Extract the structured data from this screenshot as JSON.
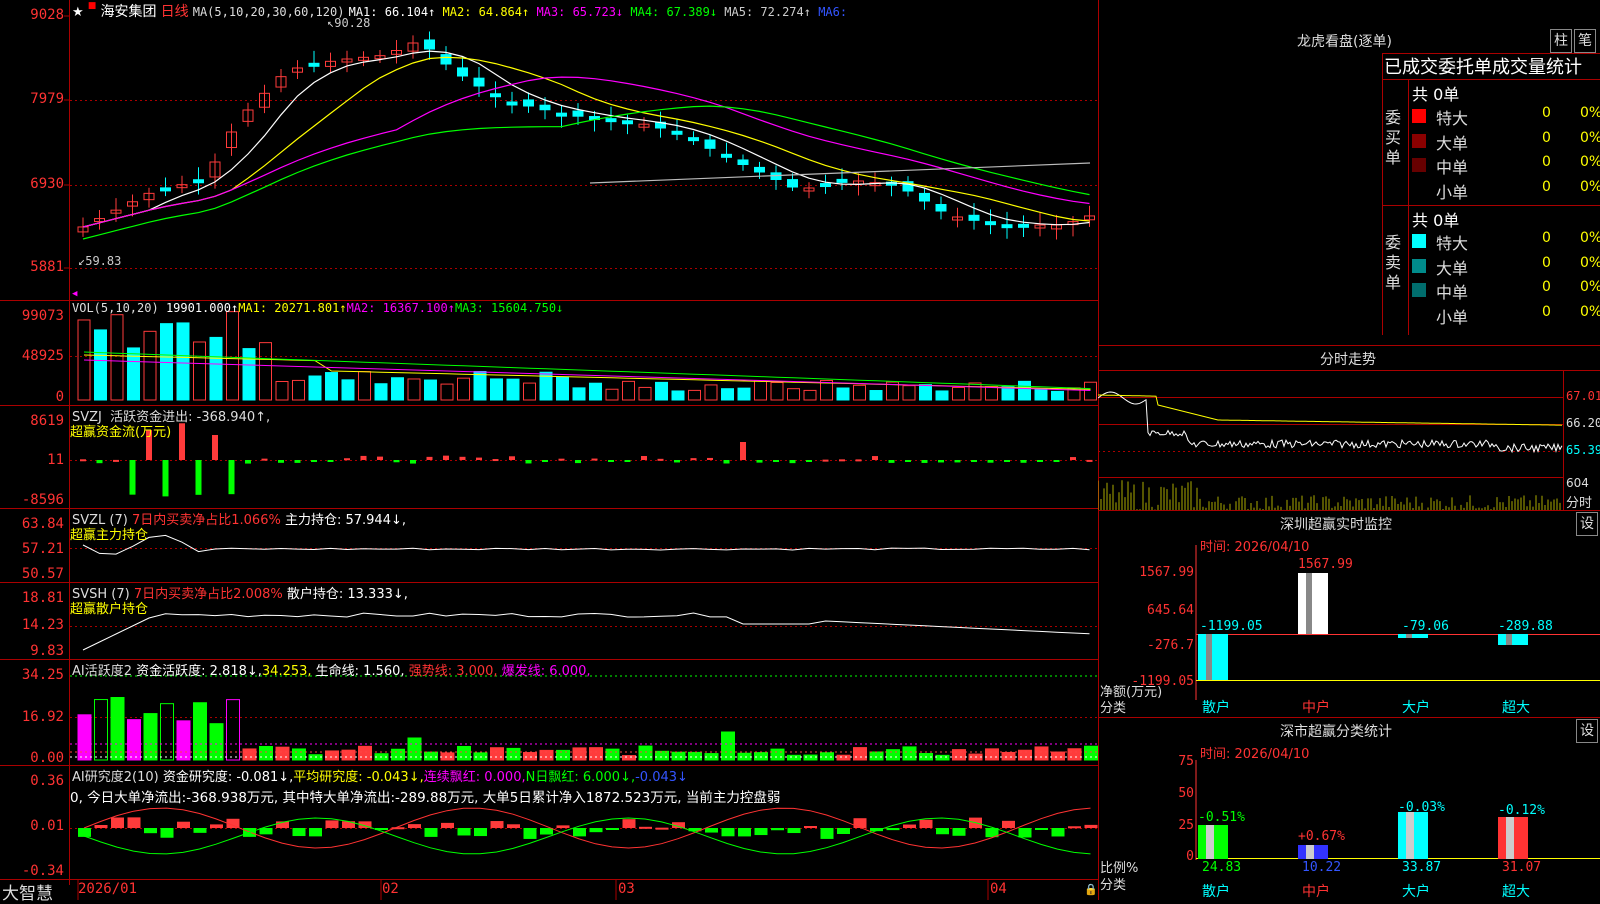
{
  "stock": {
    "star": "★",
    "name": "海安集团",
    "period": "日线",
    "ma_label": "MA(5,10,20,30,60,120)",
    "ma_items": [
      {
        "label": "MA1: 66.104↑",
        "color": "#ffffff"
      },
      {
        "label": "MA2: 64.864↑",
        "color": "#ffff00"
      },
      {
        "label": "MA3: 65.723↓",
        "color": "#ff00ff"
      },
      {
        "label": "MA4: 67.389↓",
        "color": "#00ff00"
      },
      {
        "label": "MA5: 72.274↑",
        "color": "#cccccc"
      },
      {
        "label": "MA6:",
        "color": "#3355ff"
      }
    ],
    "price_axis": [
      "9028",
      "7979",
      "6930",
      "5881"
    ],
    "price_high": "90.28",
    "price_low": "59.83"
  },
  "vol": {
    "label": "VOL(5,10,20)",
    "value": "19901.000↑",
    "ma1": "MA1: 20271.801↑",
    "ma2": "MA2: 16367.100↑",
    "ma3": "MA3: 15604.750↓",
    "axis": [
      "99073",
      "48925",
      "0"
    ]
  },
  "svzj": {
    "label": "SVZJ  活跃资金进出: -368.940↑,",
    "sub": "超赢资金流(万元)",
    "axis": [
      "8619",
      "11",
      "-8596"
    ]
  },
  "svzl": {
    "label": "SVZL (7)",
    "label2": "7日内买卖净占比1.066%",
    "label3": "主力持仓: 57.944↓,",
    "sub": "超赢主力持仓",
    "axis": [
      "63.84",
      "57.21",
      "50.57"
    ]
  },
  "svsh": {
    "label": "SVSH (7)",
    "label2": "7日内买卖净占比2.008%",
    "label3": "散户持仓: 13.333↓,",
    "sub": "超赢散户持仓",
    "axis": [
      "18.81",
      "14.23",
      "9.83"
    ]
  },
  "ai_active": {
    "label": "AI活跃度2",
    "v1": "资金活跃度: 2.818↓,",
    "v2": "34.253,",
    "v3": "生命线: 1.560,",
    "v4": "强势线: 3.000,",
    "v5": "爆发线: 6.000,",
    "axis": [
      "34.25",
      "16.92",
      "0.00"
    ]
  },
  "ai_research": {
    "label": "AI研究度2(10)",
    "v1": "资金研究度: -0.081↓,",
    "v2": "平均研究度: -0.043↓,",
    "v3": "连续飘红: 0.000,",
    "v4": "N日飘红: 6.000↓,",
    "v5": "-0.043↓",
    "desc": "0, 今日大单净流出:-368.938万元, 其中特大单净流出:-289.88万元, 大单5日累计净入1872.523万元, 当前主力控盘弱",
    "axis": [
      "0.36",
      "0.01",
      "-0.34"
    ]
  },
  "bottom": {
    "brand": "大智慧",
    "dates": [
      "2026/01",
      "02",
      "03",
      "04"
    ]
  },
  "right": {
    "lhkp_title": "龙虎看盘(逐单)",
    "btn_zhu": "柱",
    "btn_bi": "笔",
    "table_title": "已成交委托单成交量统计",
    "buy_side": "委买单",
    "sell_side": "委卖单",
    "buy_total": "共 0单",
    "sell_total": "共 0单",
    "buy_rows": [
      {
        "label": "特大",
        "count": "0",
        "pct": "0%",
        "color": "#ff0000"
      },
      {
        "label": "大单",
        "count": "0",
        "pct": "0%",
        "color": "#8b0000"
      },
      {
        "label": "中单",
        "count": "0",
        "pct": "0%",
        "color": "#660000"
      },
      {
        "label": "小单",
        "count": "0",
        "pct": "0%",
        "color": "#000000"
      }
    ],
    "sell_rows": [
      {
        "label": "特大",
        "count": "0",
        "pct": "0%",
        "color": "#00ffff"
      },
      {
        "label": "大单",
        "count": "0",
        "pct": "0%",
        "color": "#008b8b"
      },
      {
        "label": "中单",
        "count": "0",
        "pct": "0%",
        "color": "#006d6d"
      },
      {
        "label": "小单",
        "count": "0",
        "pct": "0%",
        "color": "#000000"
      }
    ],
    "fs_title": "分时走势",
    "fs_axis": [
      "67.01",
      "66.20",
      "65.39"
    ],
    "fs_vol_axis": [
      "604",
      "分时"
    ],
    "sz_title": "深圳超赢实时监控",
    "sz_btn": "设",
    "sz_time": "时间: 2026/04/10",
    "sz_axis": [
      "1567.99",
      "645.64",
      "-276.7",
      "-1199.05"
    ],
    "sz_ylabel": "净额(万元)",
    "sz_xlabel": "分类",
    "sz_values": [
      "-1199.05",
      "1567.99",
      "-79.06",
      "-289.88"
    ],
    "categories": [
      "散户",
      "中户",
      "大户",
      "超大"
    ],
    "cls_title": "深市超赢分类统计",
    "cls_btn": "设",
    "cls_time": "时间: 2026/04/10",
    "cls_axis": [
      "75",
      "50",
      "25",
      "0"
    ],
    "cls_ylabel": "比例%",
    "cls_xlabel": "分类",
    "cls_changes": [
      "-0.51%",
      "+0.67%",
      "-0.03%",
      "-0.12%"
    ],
    "cls_values": [
      "24.83",
      "10.22",
      "33.87",
      "31.07"
    ]
  },
  "colors": {
    "up": "#ff3b3b",
    "down": "#00ffff",
    "grid": "#aa0000"
  }
}
